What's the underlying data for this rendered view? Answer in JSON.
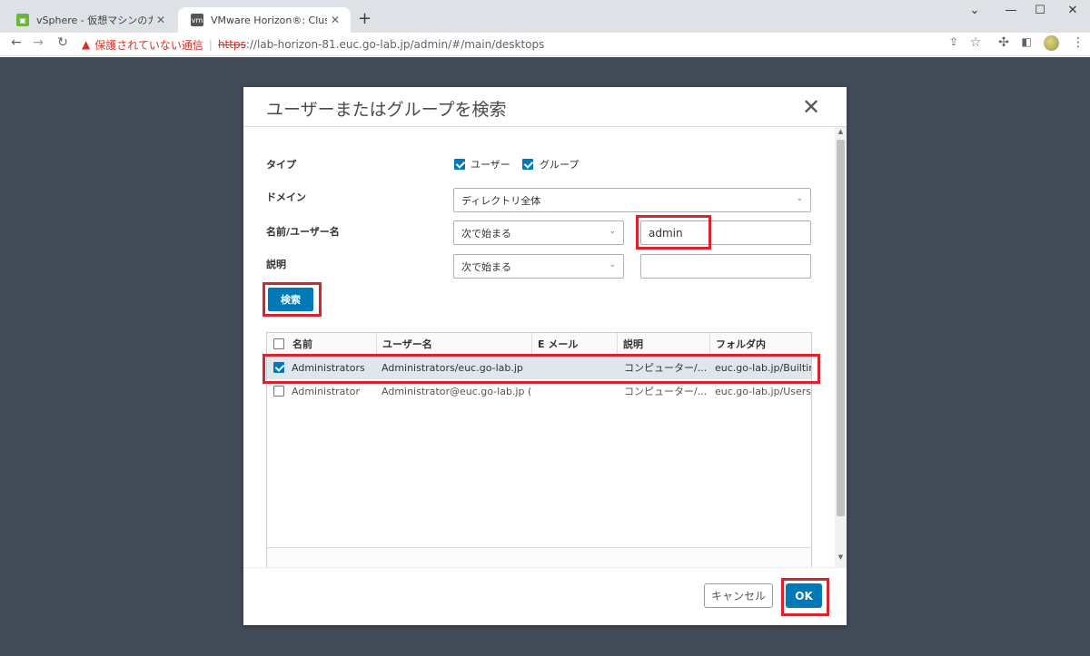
{
  "browser": {
    "tabs": [
      {
        "title": "vSphere - 仮想マシンのカスタマイズ仕様",
        "icon": "vsphere-icon"
      },
      {
        "title": "VMware Horizon®: Cluster-LAB-H",
        "icon": "vmware-icon",
        "fav_text": "vm"
      }
    ],
    "security_label": "保護されていない通信",
    "url_scheme": "https",
    "url_rest": "://lab-horizon-81.euc.go-lab.jp/admin/#/main/desktops"
  },
  "dialog": {
    "title": "ユーザーまたはグループを検索",
    "type_label": "タイプ",
    "type_user": "ユーザー",
    "type_group": "グループ",
    "domain_label": "ドメイン",
    "domain_value": "ディレクトリ全体",
    "name_label": "名前/ユーザー名",
    "name_match": "次で始まる",
    "name_value": "admin",
    "desc_label": "説明",
    "desc_match": "次で始まる",
    "desc_value": "",
    "search_button": "検索",
    "columns": [
      "名前",
      "ユーザー名",
      "E メール",
      "説明",
      "フォルダ内"
    ],
    "rows": [
      {
        "name": "Administrators",
        "username": "Administrators/euc.go-lab.jp",
        "email": "",
        "description": "コンピューター/...",
        "folder": "euc.go-lab.jp/Builtin",
        "checked": true
      },
      {
        "name": "Administrator",
        "username": "Administrator@euc.go-lab.jp (A...",
        "email": "",
        "description": "コンピューター/...",
        "folder": "euc.go-lab.jp/Users",
        "checked": false
      }
    ],
    "cancel_button": "キャンセル",
    "ok_button": "OK"
  },
  "colors": {
    "accent": "#0079b8",
    "highlight": "#d9232e",
    "backdrop": "#424c58"
  }
}
